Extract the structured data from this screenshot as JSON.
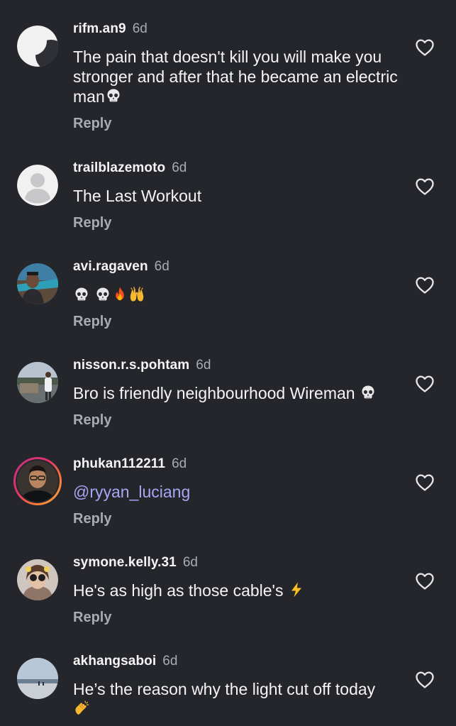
{
  "comments": [
    {
      "username": "rifm.an9",
      "time": "6d",
      "text": "The pain that doesn't kill you will make you stronger and after that he became an electric man",
      "trailing_emoji": "skull",
      "reply_label": "Reply",
      "avatar": "half-moon-avatar"
    },
    {
      "username": "trailblazemoto",
      "time": "6d",
      "text": "The Last Workout",
      "reply_label": "Reply",
      "avatar": "default-person-avatar"
    },
    {
      "username": "avi.ragaven",
      "time": "6d",
      "text": "",
      "emojis": [
        "skull",
        "skull",
        "fire",
        "raising-hands"
      ],
      "reply_label": "Reply",
      "avatar": "photo-avatar"
    },
    {
      "username": "nisson.r.s.pohtam",
      "time": "6d",
      "text": "Bro is friendly neighbourhood Wireman",
      "trailing_emoji": "skull",
      "reply_label": "Reply",
      "avatar": "photo-avatar"
    },
    {
      "username": "phukan112211",
      "time": "6d",
      "text": "@ryyan_luciang",
      "reply_label": "Reply",
      "avatar": "story-ring-avatar"
    },
    {
      "username": "symone.kelly.31",
      "time": "6d",
      "text": "He's as high as those cable's",
      "trailing_emoji": "high-voltage",
      "reply_label": "Reply",
      "avatar": "photo-avatar"
    },
    {
      "username": "akhangsaboi",
      "time": "6d",
      "text": "He’s the reason why the light cut off today",
      "trailing_emoji": "clapping-hands",
      "avatar": "photo-avatar"
    }
  ],
  "colors": {
    "background": "#24262b",
    "primary_text": "#f5f5f5",
    "secondary_text": "#a9abb0",
    "mention": "#a6a6f5"
  }
}
